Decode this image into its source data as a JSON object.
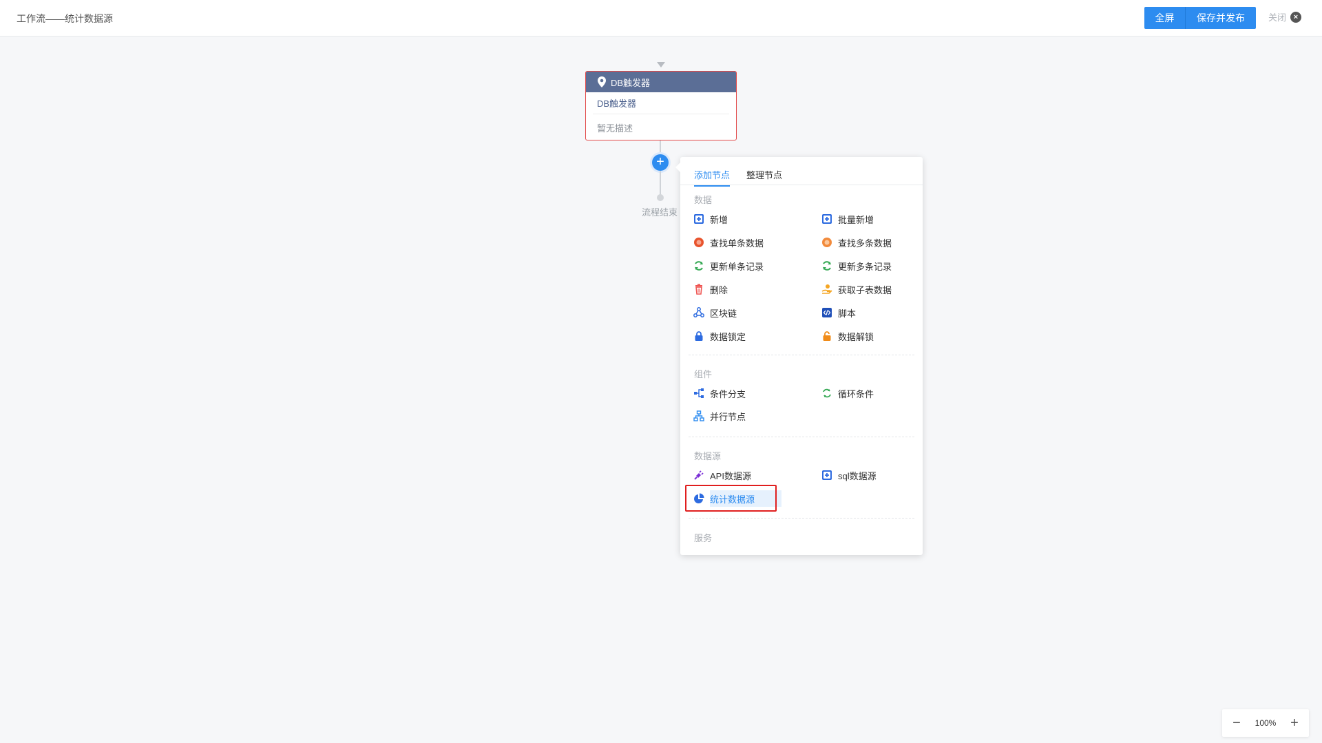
{
  "header": {
    "title": "工作流——统计数据源",
    "fullscreen_label": "全屏",
    "publish_label": "保存并发布",
    "close_label": "关闭"
  },
  "flow": {
    "node": {
      "header_label": "DB触发器",
      "name": "DB触发器",
      "description": "暂无描述"
    },
    "end_label": "流程结束"
  },
  "popover": {
    "tabs": [
      "添加节点",
      "整理节点"
    ],
    "active_tab": "添加节点",
    "sections": {
      "data": {
        "title": "数据",
        "items": [
          "新增",
          "批量新增",
          "查找单条数据",
          "查找多条数据",
          "更新单条记录",
          "更新多条记录",
          "删除",
          "获取子表数据",
          "区块链",
          "脚本",
          "数据锁定",
          "数据解锁"
        ]
      },
      "components": {
        "title": "组件",
        "items": [
          "条件分支",
          "循环条件",
          "并行节点"
        ]
      },
      "datasource": {
        "title": "数据源",
        "items": [
          "API数据源",
          "sql数据源",
          "统计数据源"
        ],
        "selected": "统计数据源"
      },
      "service": {
        "title": "服务"
      }
    }
  },
  "zoom": {
    "level": "100%"
  },
  "colors": {
    "primary": "#2d8cf0",
    "node_header": "#5b6e96",
    "node_border": "#e24848",
    "highlight": "#e01e1e"
  }
}
